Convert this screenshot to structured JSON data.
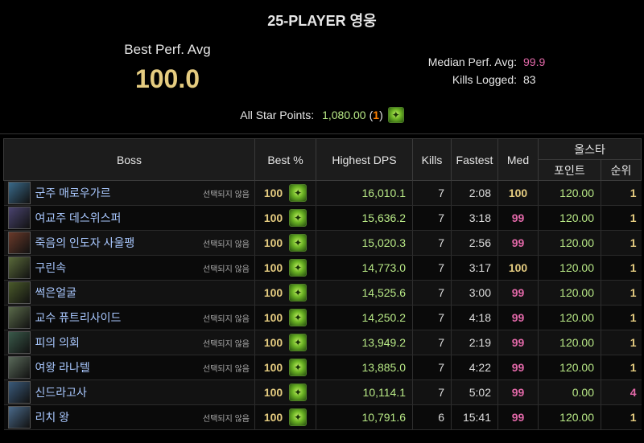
{
  "header": {
    "title": "25-PLAYER 영웅",
    "best_perf_label": "Best Perf. Avg",
    "best_perf_value": "100.0",
    "median_label": "Median Perf. Avg:",
    "median_value": "99.9",
    "kills_label": "Kills Logged:",
    "kills_value": "83",
    "allstar_label": "All Star Points:",
    "allstar_points": "1,080.00",
    "allstar_rank_open": "(",
    "allstar_rank": "1",
    "allstar_rank_close": ")"
  },
  "columns": {
    "boss": "Boss",
    "best": "Best %",
    "dps": "Highest DPS",
    "kills": "Kills",
    "fastest": "Fastest",
    "med": "Med",
    "allstar": "올스타",
    "points": "포인트",
    "rank": "순위"
  },
  "rows": [
    {
      "name": "군주 매로우가르",
      "note": "선택되지 않음",
      "best": "100",
      "dps": "16,010.1",
      "kills": "7",
      "fastest": "2:08",
      "med": "100",
      "med_color": "gold",
      "points": "120.00",
      "rank": "1",
      "rank_color": "gold",
      "avatar_color": "#3a6a8a"
    },
    {
      "name": "여교주 데스위스퍼",
      "note": "",
      "best": "100",
      "dps": "15,636.2",
      "kills": "7",
      "fastest": "3:18",
      "med": "99",
      "med_color": "pink",
      "points": "120.00",
      "rank": "1",
      "rank_color": "gold",
      "avatar_color": "#4a4470"
    },
    {
      "name": "죽음의 인도자 사울팽",
      "note": "선택되지 않음",
      "best": "100",
      "dps": "15,020.3",
      "kills": "7",
      "fastest": "2:56",
      "med": "99",
      "med_color": "pink",
      "points": "120.00",
      "rank": "1",
      "rank_color": "gold",
      "avatar_color": "#6a3a2a"
    },
    {
      "name": "구린속",
      "note": "선택되지 않음",
      "best": "100",
      "dps": "14,773.0",
      "kills": "7",
      "fastest": "3:17",
      "med": "100",
      "med_color": "gold",
      "points": "120.00",
      "rank": "1",
      "rank_color": "gold",
      "avatar_color": "#5a6a3a"
    },
    {
      "name": "썩은얼굴",
      "note": "",
      "best": "100",
      "dps": "14,525.6",
      "kills": "7",
      "fastest": "3:00",
      "med": "99",
      "med_color": "pink",
      "points": "120.00",
      "rank": "1",
      "rank_color": "gold",
      "avatar_color": "#4a5a2a"
    },
    {
      "name": "교수 퓨트리사이드",
      "note": "선택되지 않음",
      "best": "100",
      "dps": "14,250.2",
      "kills": "7",
      "fastest": "4:18",
      "med": "99",
      "med_color": "pink",
      "points": "120.00",
      "rank": "1",
      "rank_color": "gold",
      "avatar_color": "#5a6a4a"
    },
    {
      "name": "피의 의회",
      "note": "선택되지 않음",
      "best": "100",
      "dps": "13,949.2",
      "kills": "7",
      "fastest": "2:19",
      "med": "99",
      "med_color": "pink",
      "points": "120.00",
      "rank": "1",
      "rank_color": "gold",
      "avatar_color": "#3a5a4a"
    },
    {
      "name": "여왕 라나텔",
      "note": "선택되지 않음",
      "best": "100",
      "dps": "13,885.0",
      "kills": "7",
      "fastest": "4:22",
      "med": "99",
      "med_color": "pink",
      "points": "120.00",
      "rank": "1",
      "rank_color": "gold",
      "avatar_color": "#5a6a5a"
    },
    {
      "name": "신드라고사",
      "note": "",
      "best": "100",
      "dps": "10,114.1",
      "kills": "7",
      "fastest": "5:02",
      "med": "99",
      "med_color": "pink",
      "points": "0.00",
      "rank": "4",
      "rank_color": "pink",
      "avatar_color": "#3a5a7a"
    },
    {
      "name": "리치 왕",
      "note": "선택되지 않음",
      "best": "100",
      "dps": "10,791.6",
      "kills": "6",
      "fastest": "15:41",
      "med": "99",
      "med_color": "pink",
      "points": "120.00",
      "rank": "1",
      "rank_color": "gold",
      "avatar_color": "#4a6a8a"
    }
  ]
}
